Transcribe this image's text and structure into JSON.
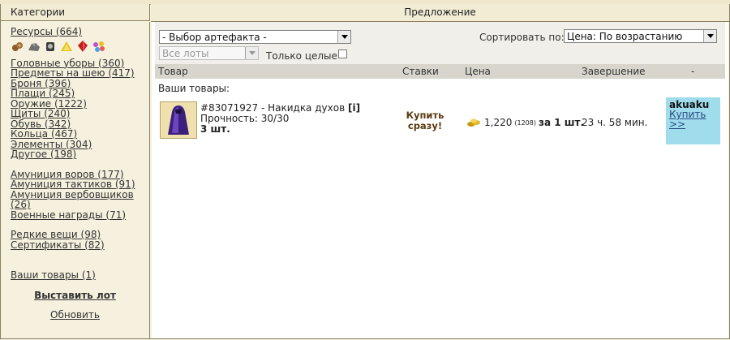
{
  "header": {
    "categories": "Категории",
    "offers": "Предложение"
  },
  "sidebar": {
    "resources": "Ресурсы (664)",
    "resource_icons": [
      "wood-icon",
      "ore-icon",
      "mercury-icon",
      "sulfur-icon",
      "crystal-icon",
      "gems-icon"
    ],
    "group1": [
      "Головные уборы (360)",
      "Предметы на шею (417)",
      "Броня (396)",
      "Плащи (245)",
      "Оружие (1222)",
      "Щиты (240)",
      "Обувь (342)",
      "Кольца (467)",
      "Элементы (304)",
      "Другое (198)"
    ],
    "group2": [
      "Амуниция воров (177)",
      "Амуниция тактиков (91)",
      "Амуниция вербовщиков (26)",
      "Военные награды (71)"
    ],
    "group3": [
      "Редкие вещи (98)",
      "Сертификаты (82)"
    ],
    "my_items": "Ваши товары (1)",
    "post_lot": "Выставить лот",
    "refresh": "Обновить"
  },
  "toolbar": {
    "artifact_select": "- Выбор артефакта -",
    "lots_select": "Все лоты",
    "whole_only": "Только целые",
    "sort_label": "Сортировать по:",
    "sort_select": "Цена: По возрастанию"
  },
  "columns": {
    "item": "Товар",
    "bids": "Ставки",
    "price": "Цена",
    "ends": "Завершение",
    "dash": "-"
  },
  "section_label": "Ваши товары:",
  "lot": {
    "title_prefix": "#83071927 - Накидка духов",
    "info_marker": "[i]",
    "durability": "Прочность: 30/30",
    "quantity": "3 шт.",
    "buy_now": "Купить сразу!",
    "price": "1,220",
    "price_small": "(1208)",
    "per_unit": "за 1 шт.",
    "ends": "23 ч. 58 мин.",
    "seller": "akuaku",
    "buy_link": "Купить >>"
  },
  "colors": {
    "seller_bg": "#9fdcec",
    "panel_bg": "#f5f1de",
    "header_row_bg": "#d8d6cc"
  }
}
